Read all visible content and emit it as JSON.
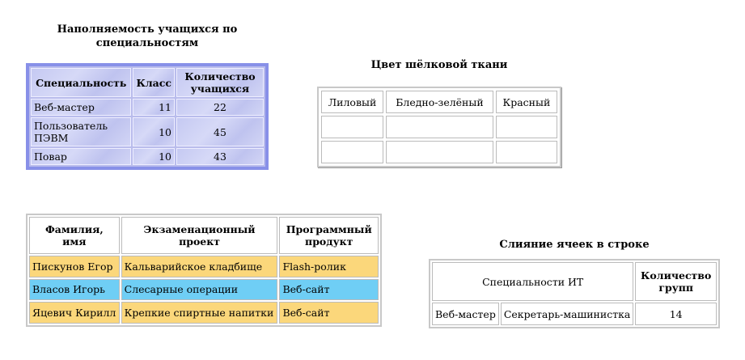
{
  "table1": {
    "caption": "Наполняемость учащихся по специальностям",
    "headers": [
      "Специальность",
      "Класс",
      "Количество учащихся"
    ],
    "rows": [
      [
        "Веб-мастер",
        "11",
        "22"
      ],
      [
        "Пользователь ПЭВМ",
        "10",
        "45"
      ],
      [
        "Повар",
        "10",
        "43"
      ]
    ],
    "border_color": "#8890e8",
    "background_color": "#c9ccf3"
  },
  "table2": {
    "caption": "Цвет шёлковой ткани",
    "headers": [
      "Лиловый",
      "Бледно-зелёный",
      "Красный"
    ],
    "rows": [
      [
        "",
        "",
        ""
      ],
      [
        "",
        "",
        ""
      ]
    ]
  },
  "table3": {
    "headers": [
      "Фамилия, имя",
      "Экзаменационный проект",
      "Программный продукт"
    ],
    "rows": [
      [
        "Пискунов Егор",
        "Кальварийское кладбище",
        "Flash-ролик"
      ],
      [
        "Власов Игорь",
        "Слесарные операции",
        "Веб-сайт"
      ],
      [
        "Яцевич Кирилл",
        "Крепкие спиртные напитки",
        "Веб-сайт"
      ]
    ],
    "row_colors": [
      "#fbd77b",
      "#6fcef5",
      "#fbd77b"
    ]
  },
  "table4": {
    "caption": "Слияние ячеек в строке",
    "header_merged": "Специальности ИТ",
    "header_count": "Количество групп",
    "row": [
      "Веб-мастер",
      "Секретарь-машинистка",
      "14"
    ]
  }
}
